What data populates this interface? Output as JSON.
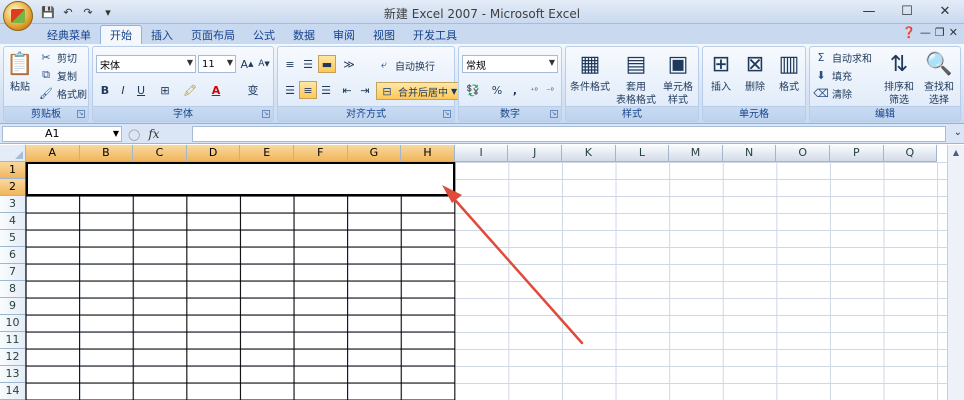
{
  "window": {
    "title": "新建 Excel 2007 - Microsoft Excel",
    "controls": [
      "minimize",
      "maximize",
      "close"
    ]
  },
  "quick_access": [
    "save-icon",
    "undo-icon",
    "redo-icon",
    "customize-icon"
  ],
  "tabs": [
    "经典菜单",
    "开始",
    "插入",
    "页面布局",
    "公式",
    "数据",
    "审阅",
    "视图",
    "开发工具"
  ],
  "active_tab": "开始",
  "ribbon": {
    "clipboard": {
      "label": "剪贴板",
      "paste": "粘贴",
      "cut": "剪切",
      "copy": "复制",
      "format_painter": "格式刷"
    },
    "font": {
      "label": "字体",
      "font_name": "宋体",
      "font_size": "11",
      "bold": "B",
      "italic": "I",
      "underline": "U",
      "fill_letter": "A",
      "phonetic": "变"
    },
    "alignment": {
      "label": "对齐方式",
      "wrap_text": "自动换行",
      "merge_center": "合并后居中"
    },
    "number": {
      "label": "数字",
      "format": "常规",
      "percent": "%",
      "comma": ","
    },
    "styles": {
      "label": "样式",
      "conditional": "条件格式",
      "table_line1": "套用",
      "table_line2": "表格格式",
      "cell_line1": "单元格",
      "cell_line2": "样式"
    },
    "cells": {
      "label": "单元格",
      "insert": "插入",
      "delete": "删除",
      "format": "格式"
    },
    "editing": {
      "label": "编辑",
      "autosum": "自动求和",
      "fill": "填充",
      "clear": "清除",
      "sort_line1": "排序和",
      "sort_line2": "筛选",
      "find_line1": "查找和",
      "find_line2": "选择"
    }
  },
  "formula_bar": {
    "name_box": "A1",
    "fx": "fx",
    "value": ""
  },
  "columns": [
    "A",
    "B",
    "C",
    "D",
    "E",
    "F",
    "G",
    "H",
    "I",
    "J",
    "K",
    "L",
    "M",
    "N",
    "O",
    "P",
    "Q"
  ],
  "selected_columns": [
    "A",
    "B",
    "C",
    "D",
    "E",
    "F",
    "G",
    "H"
  ],
  "rows": [
    "1",
    "2",
    "3",
    "4",
    "5",
    "6",
    "7",
    "8",
    "9",
    "10",
    "11",
    "12",
    "13",
    "14"
  ],
  "selected_rows": [
    "1",
    "2"
  ],
  "colors": {
    "accent": "#f1b55c",
    "annotation_arrow": "#e04a3a",
    "ribbon": "#dce8f8"
  }
}
